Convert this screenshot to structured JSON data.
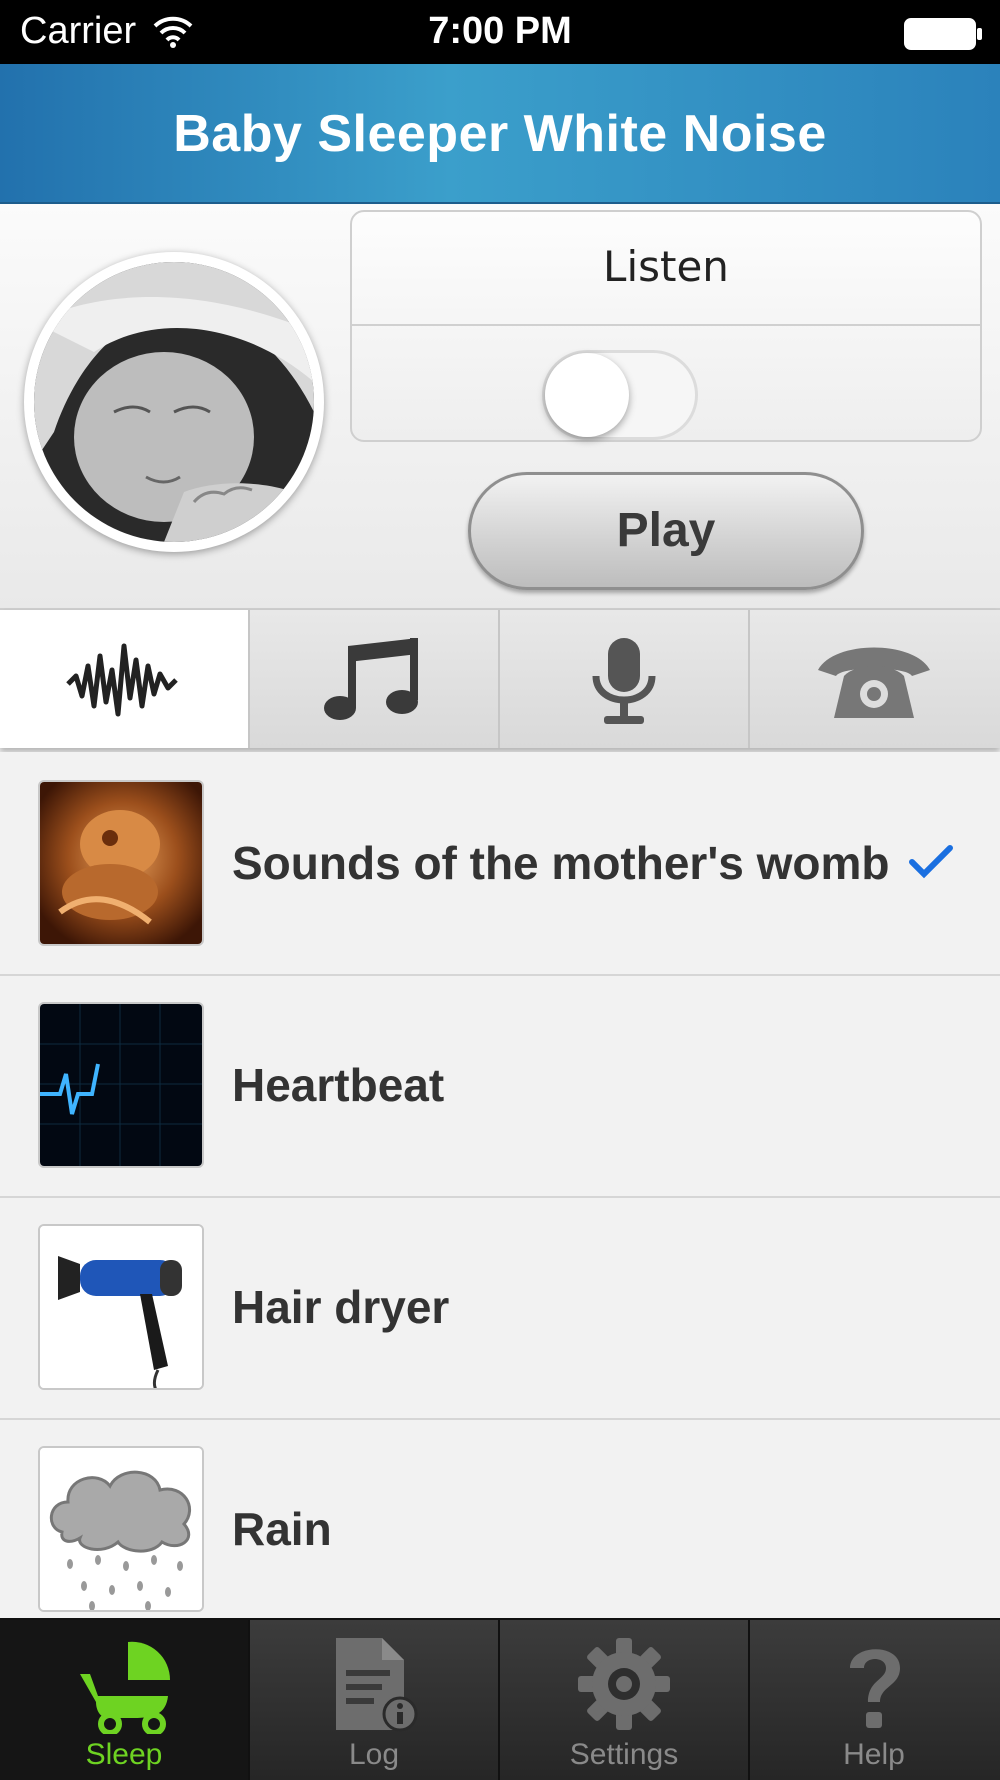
{
  "status_bar": {
    "carrier": "Carrier",
    "time": "7:00 PM"
  },
  "nav": {
    "title": "Baby Sleeper White Noise"
  },
  "controls": {
    "listen_label": "Listen",
    "listen_on": false,
    "play_label": "Play"
  },
  "category_tabs": [
    {
      "icon": "waveform-icon",
      "active": true
    },
    {
      "icon": "music-note-icon",
      "active": false
    },
    {
      "icon": "microphone-icon",
      "active": false
    },
    {
      "icon": "telephone-icon",
      "active": false
    }
  ],
  "sounds": [
    {
      "label": "Sounds of the mother's womb",
      "icon": "womb-thumbnail",
      "selected": true
    },
    {
      "label": "Heartbeat",
      "icon": "heartbeat-thumbnail",
      "selected": false
    },
    {
      "label": "Hair dryer",
      "icon": "hair-dryer-thumbnail",
      "selected": false
    },
    {
      "label": "Rain",
      "icon": "rain-cloud-thumbnail",
      "selected": false
    }
  ],
  "tab_bar": [
    {
      "label": "Sleep",
      "icon": "stroller-icon",
      "active": true
    },
    {
      "label": "Log",
      "icon": "log-document-icon",
      "active": false
    },
    {
      "label": "Settings",
      "icon": "gear-icon",
      "active": false
    },
    {
      "label": "Help",
      "icon": "question-mark-icon",
      "active": false
    }
  ],
  "colors": {
    "nav_blue": "#2b82bb",
    "active_tab_green": "#6ed322",
    "checkmark_blue": "#1a6fe0"
  }
}
